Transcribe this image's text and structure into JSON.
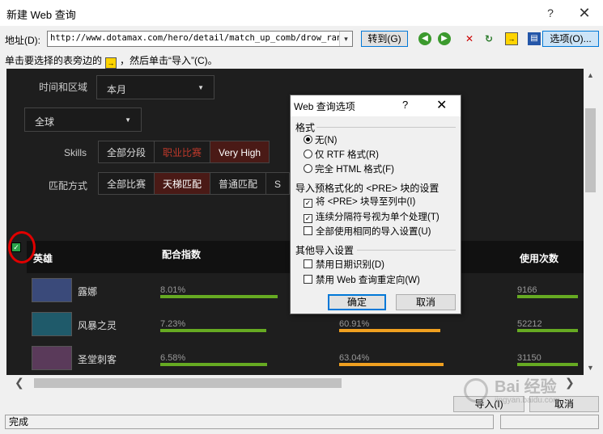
{
  "window": {
    "title": "新建 Web 查询",
    "help": "?",
    "close": "✕"
  },
  "toolbar": {
    "address_label": "地址(D):",
    "address_value": "http://www.dotamax.com/hero/detail/match_up_comb/drow_ranger/",
    "dropdown": "▾",
    "goto_label": "转到(G)",
    "options_label": "选项(O)...",
    "icons": [
      "back-icon",
      "forward-icon",
      "stop-icon",
      "refresh-icon",
      "show-icons-icon",
      "save-query-icon"
    ],
    "glyph_back": "◀",
    "glyph_forward": "▶",
    "glyph_stop": "✕",
    "glyph_refresh": "↻",
    "glyph_show": "→",
    "glyph_save": "▤"
  },
  "hint": {
    "before": "单击要选择的表旁边的",
    "after": "，然后单击“导入”(C)。",
    "glyph": "→"
  },
  "webview": {
    "time_region_label": "时间和区域",
    "month_select": "本月",
    "region_select": "全球",
    "caret": "▼",
    "skills_label": "Skills",
    "skills_options": [
      "全部分段",
      "职业比赛",
      "Very High"
    ],
    "match_mode_label": "匹配方式",
    "match_options": [
      "全部比赛",
      "天梯匹配",
      "普通匹配",
      "S"
    ],
    "columns": {
      "hero": "英雄",
      "match_index": "配合指数",
      "uses": "使用次数"
    },
    "rows": [
      {
        "name": "露娜",
        "index": "8.01%",
        "win": "",
        "uses": "9166"
      },
      {
        "name": "风暴之灵",
        "index": "7.23%",
        "win": "60.91%",
        "uses": "52212"
      },
      {
        "name": "圣堂刺客",
        "index": "6.58%",
        "win": "63.04%",
        "uses": "31150"
      }
    ],
    "check_glyph": "✓"
  },
  "scroll": {
    "up": "▲",
    "down": "▼",
    "left": "❮",
    "right": "❯"
  },
  "dialog": {
    "title": "Web 查询选项",
    "help": "?",
    "close": "✕",
    "format_group": "格式",
    "format_options": [
      "无(N)",
      "仅 RTF 格式(R)",
      "完全 HTML 格式(F)"
    ],
    "pre_group": "导入预格式化的 <PRE> 块的设置",
    "pre_options": [
      "将 <PRE> 块导至列中(I)",
      "连续分隔符号视为单个处理(T)",
      "全部使用相同的导入设置(U)"
    ],
    "other_group": "其他导入设置",
    "other_options": [
      "禁用日期识别(D)",
      "禁用 Web 查询重定向(W)"
    ],
    "check_glyph": "✓",
    "ok": "确定",
    "cancel": "取消"
  },
  "bottom": {
    "import_label": "导入(I)",
    "cancel_label": "取消",
    "status": "完成"
  },
  "watermark": {
    "text": "Bai 经验",
    "sub": "jingyan.baidu.com"
  },
  "colors": {
    "accent": "#0078d7",
    "green_bar": "#66aa22",
    "orange_bar": "#f0a020",
    "highlight_red": "#c0392b",
    "active_segment": "#4a1a16"
  }
}
